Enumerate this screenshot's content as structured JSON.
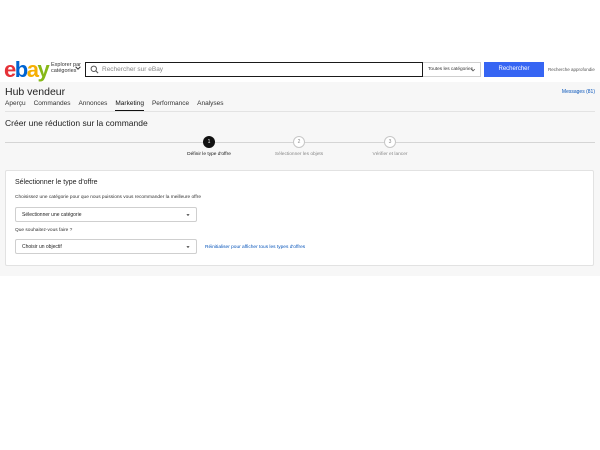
{
  "header": {
    "logo": {
      "letters": [
        "e",
        "b",
        "a",
        "y"
      ],
      "colors": [
        "#e53238",
        "#0064d2",
        "#f5af02",
        "#86b817"
      ]
    },
    "explore_label": "Explorer par catégories",
    "search_placeholder": "Rechercher sur eBay",
    "category_select": "Toutes les catégories",
    "search_button": "Rechercher",
    "advanced_search": "Recherche approfondie"
  },
  "hub": {
    "title": "Hub vendeur",
    "messages": "Messages (81)",
    "tabs": [
      {
        "label": "Aperçu",
        "active": false
      },
      {
        "label": "Commandes",
        "active": false
      },
      {
        "label": "Annonces",
        "active": false
      },
      {
        "label": "Marketing",
        "active": true
      },
      {
        "label": "Performance",
        "active": false
      },
      {
        "label": "Analyses",
        "active": false
      }
    ]
  },
  "page": {
    "heading": "Créer une réduction sur la commande"
  },
  "stepper": {
    "steps": [
      {
        "number": "1",
        "label": "Définir le type d'offre",
        "active": true
      },
      {
        "number": "2",
        "label": "Sélectionner les objets",
        "active": false
      },
      {
        "number": "3",
        "label": "Vérifier et lancer",
        "active": false
      }
    ]
  },
  "card": {
    "title": "Sélectionner le type d'offre",
    "description": "Choisissez une catégorie pour que nous puissions vous recommander la meilleure offre",
    "category_select": "Sélectionner une catégorie",
    "goal_label": "Que souhaitez-vous faire ?",
    "goal_select": "Choisir un objectif",
    "reset_link": "Réinitialiser pour afficher tous les types d'offres"
  },
  "colors": {
    "accent": "#3665f3",
    "link": "#0654ba"
  }
}
